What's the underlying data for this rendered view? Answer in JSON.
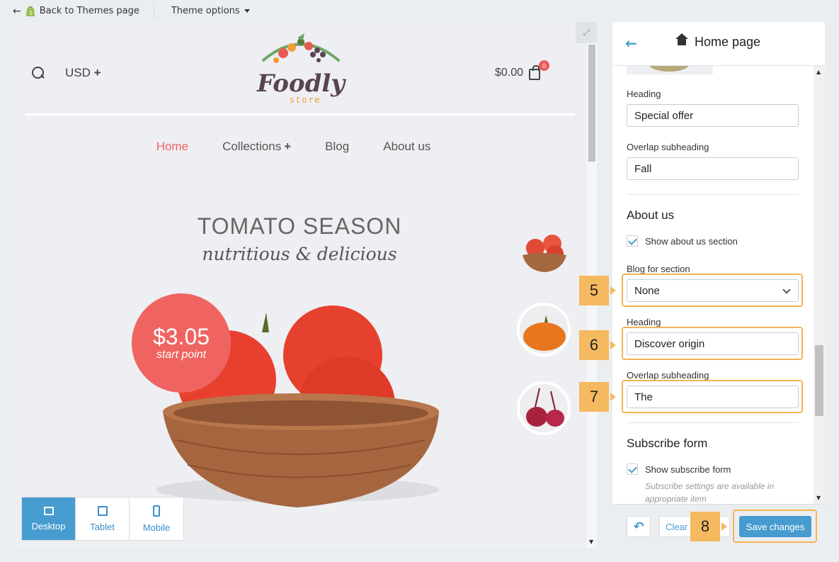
{
  "topbar": {
    "back_label": "Back to Themes page",
    "theme_options_label": "Theme options"
  },
  "store": {
    "currency": "USD",
    "cart_total": "$0.00",
    "cart_count": "0",
    "logo_word": "Foodly",
    "logo_sub": "store",
    "nav": [
      {
        "label": "Home",
        "active": true
      },
      {
        "label": "Collections",
        "has_plus": true
      },
      {
        "label": "Blog"
      },
      {
        "label": "About us"
      }
    ],
    "hero_title": "TOMATO SEASON",
    "hero_subtitle": "nutritious & delicious",
    "price_amount": "$3.05",
    "price_label": "start point"
  },
  "device_bar": {
    "items": [
      {
        "label": "Desktop",
        "active": true
      },
      {
        "label": "Tablet"
      },
      {
        "label": "Mobile"
      }
    ]
  },
  "panel": {
    "title": "Home page",
    "fields": {
      "heading1_label": "Heading",
      "heading1_value": "Special offer",
      "overlap1_label": "Overlap subheading",
      "overlap1_value": "Fall",
      "about_title": "About us",
      "show_about_label": "Show about us section",
      "blog_label": "Blog for section",
      "blog_value": "None",
      "heading2_label": "Heading",
      "heading2_value": "Discover origin",
      "overlap2_label": "Overlap subheading",
      "overlap2_value": "The",
      "subscribe_title": "Subscribe form",
      "show_subscribe_label": "Show subscribe form",
      "subscribe_hint": "Subscribe settings are available in appropriate item"
    },
    "footer": {
      "clear_label": "Clear",
      "save_label": "Save changes"
    }
  },
  "callouts": {
    "n5": "5",
    "n6": "6",
    "n7": "7",
    "n8": "8"
  },
  "colors": {
    "accent": "#479ccf",
    "brand_red": "#ef6461",
    "callout": "#f5b95f"
  }
}
